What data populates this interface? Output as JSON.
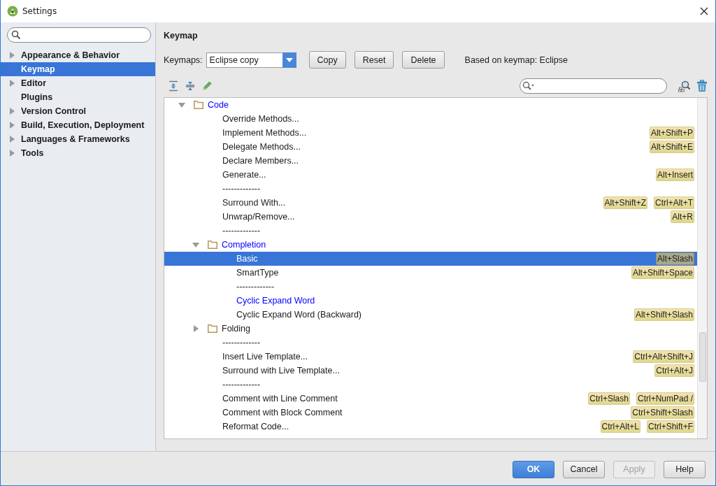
{
  "window": {
    "title": "Settings"
  },
  "sidebar": {
    "items": [
      {
        "label": "Appearance & Behavior",
        "expandable": true,
        "selected": false
      },
      {
        "label": "Keymap",
        "expandable": false,
        "selected": true
      },
      {
        "label": "Editor",
        "expandable": true,
        "selected": false
      },
      {
        "label": "Plugins",
        "expandable": false,
        "selected": false
      },
      {
        "label": "Version Control",
        "expandable": true,
        "selected": false
      },
      {
        "label": "Build, Execution, Deployment",
        "expandable": true,
        "selected": false
      },
      {
        "label": "Languages & Frameworks",
        "expandable": true,
        "selected": false
      },
      {
        "label": "Tools",
        "expandable": true,
        "selected": false
      }
    ]
  },
  "panel": {
    "title": "Keymap",
    "keymaps_label": "Keymaps:",
    "keymap_value": "Eclipse copy",
    "buttons": [
      {
        "label": "Copy"
      },
      {
        "label": "Reset"
      },
      {
        "label": "Delete"
      }
    ],
    "based_on": "Based on keymap: Eclipse",
    "tree": [
      {
        "kind": "folder",
        "label": "Code",
        "modified": true,
        "expanded": true,
        "selected": false,
        "children": [
          {
            "kind": "action",
            "label": "Override Methods...",
            "modified": false,
            "selected": false
          },
          {
            "kind": "action",
            "label": "Implement Methods...",
            "modified": false,
            "selected": false,
            "shortcuts": [
              "Alt+Shift+P"
            ]
          },
          {
            "kind": "action",
            "label": "Delegate Methods...",
            "modified": false,
            "selected": false,
            "shortcuts": [
              "Alt+Shift+E"
            ]
          },
          {
            "kind": "action",
            "label": "Declare Members...",
            "modified": false,
            "selected": false
          },
          {
            "kind": "action",
            "label": "Generate...",
            "modified": false,
            "selected": false,
            "shortcuts": [
              "Alt+Insert"
            ]
          },
          {
            "kind": "separator",
            "label": "-------------",
            "selected": false
          },
          {
            "kind": "action",
            "label": "Surround With...",
            "modified": false,
            "selected": false,
            "shortcuts": [
              "Alt+Shift+Z",
              "Ctrl+Alt+T"
            ]
          },
          {
            "kind": "action",
            "label": "Unwrap/Remove...",
            "modified": false,
            "selected": false,
            "shortcuts": [
              "Alt+R"
            ]
          },
          {
            "kind": "separator",
            "label": "-------------",
            "selected": false
          },
          {
            "kind": "folder",
            "label": "Completion",
            "modified": true,
            "expanded": true,
            "selected": false,
            "children": [
              {
                "kind": "action",
                "label": "Basic",
                "modified": false,
                "selected": true,
                "shortcuts": [
                  "Alt+Slash"
                ]
              },
              {
                "kind": "action",
                "label": "SmartType",
                "modified": false,
                "selected": false,
                "shortcuts": [
                  "Alt+Shift+Space"
                ]
              },
              {
                "kind": "separator",
                "label": "-------------",
                "selected": false
              },
              {
                "kind": "action",
                "label": "Cyclic Expand Word",
                "modified": true,
                "selected": false
              },
              {
                "kind": "action",
                "label": "Cyclic Expand Word (Backward)",
                "modified": false,
                "selected": false,
                "shortcuts": [
                  "Alt+Shift+Slash"
                ]
              }
            ]
          },
          {
            "kind": "folder",
            "label": "Folding",
            "modified": false,
            "expanded": false,
            "selected": false
          },
          {
            "kind": "separator",
            "label": "-------------",
            "selected": false
          },
          {
            "kind": "action",
            "label": "Insert Live Template...",
            "modified": false,
            "selected": false,
            "shortcuts": [
              "Ctrl+Alt+Shift+J"
            ]
          },
          {
            "kind": "action",
            "label": "Surround with Live Template...",
            "modified": false,
            "selected": false,
            "shortcuts": [
              "Ctrl+Alt+J"
            ]
          },
          {
            "kind": "separator",
            "label": "-------------",
            "selected": false
          },
          {
            "kind": "action",
            "label": "Comment with Line Comment",
            "modified": false,
            "selected": false,
            "shortcuts": [
              "Ctrl+Slash",
              "Ctrl+NumPad /"
            ]
          },
          {
            "kind": "action",
            "label": "Comment with Block Comment",
            "modified": false,
            "selected": false,
            "shortcuts": [
              "Ctrl+Shift+Slash"
            ]
          },
          {
            "kind": "action",
            "label": "Reformat Code...",
            "modified": false,
            "selected": false,
            "shortcuts": [
              "Ctrl+Alt+L",
              "Ctrl+Shift+F"
            ]
          }
        ]
      }
    ]
  },
  "footer": {
    "buttons": [
      {
        "label": "OK",
        "kind": "primary",
        "disabled": false
      },
      {
        "label": "Cancel",
        "kind": "normal",
        "disabled": false
      },
      {
        "label": "Apply",
        "kind": "normal",
        "disabled": true
      },
      {
        "label": "Help",
        "kind": "normal",
        "disabled": false
      }
    ]
  }
}
